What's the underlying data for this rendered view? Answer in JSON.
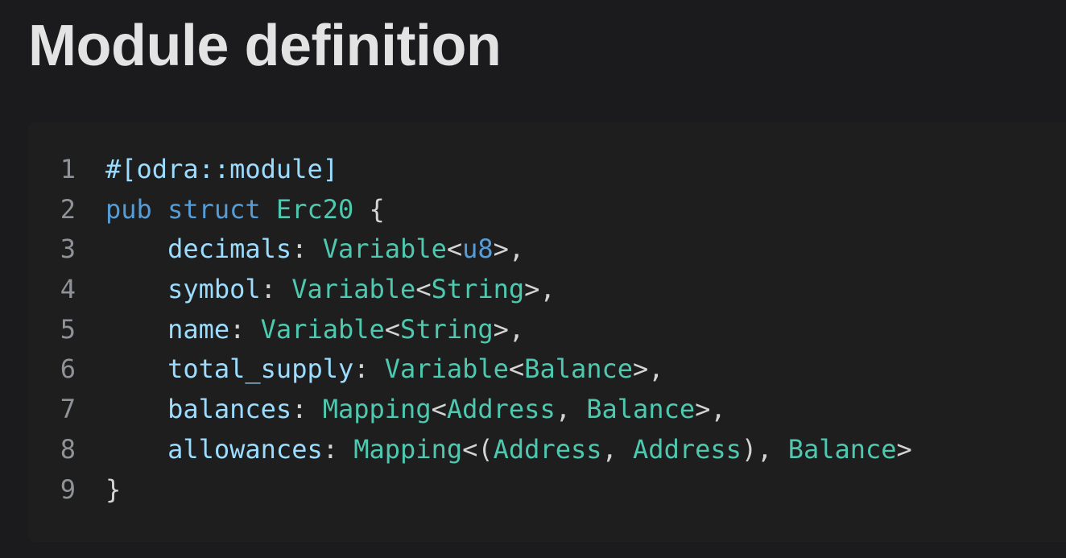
{
  "page": {
    "title": "Module definition"
  },
  "colors": {
    "background": "#1b1b1d",
    "code_background": "#1e1e1e",
    "title_text": "#e3e3e3",
    "line_number": "#8f9398",
    "attribute": "#9cdcfe",
    "keyword": "#569cd6",
    "type": "#4ec9b0",
    "field": "#9cdcfe",
    "punctuation": "#d4d4d4"
  },
  "code": {
    "lines": [
      {
        "number": "1",
        "tokens": [
          {
            "text": "#[odra::module]",
            "kind": "attr"
          }
        ]
      },
      {
        "number": "2",
        "tokens": [
          {
            "text": "pub",
            "kind": "kw"
          },
          {
            "text": " ",
            "kind": "plain"
          },
          {
            "text": "struct",
            "kind": "kw"
          },
          {
            "text": " ",
            "kind": "plain"
          },
          {
            "text": "Erc20",
            "kind": "type"
          },
          {
            "text": " {",
            "kind": "plain"
          }
        ]
      },
      {
        "number": "3",
        "tokens": [
          {
            "text": "    ",
            "kind": "plain"
          },
          {
            "text": "decimals",
            "kind": "field"
          },
          {
            "text": ": ",
            "kind": "plain"
          },
          {
            "text": "Variable",
            "kind": "type"
          },
          {
            "text": "<",
            "kind": "plain"
          },
          {
            "text": "u8",
            "kind": "kw"
          },
          {
            "text": ">,",
            "kind": "plain"
          }
        ]
      },
      {
        "number": "4",
        "tokens": [
          {
            "text": "    ",
            "kind": "plain"
          },
          {
            "text": "symbol",
            "kind": "field"
          },
          {
            "text": ": ",
            "kind": "plain"
          },
          {
            "text": "Variable",
            "kind": "type"
          },
          {
            "text": "<",
            "kind": "plain"
          },
          {
            "text": "String",
            "kind": "type"
          },
          {
            "text": ">,",
            "kind": "plain"
          }
        ]
      },
      {
        "number": "5",
        "tokens": [
          {
            "text": "    ",
            "kind": "plain"
          },
          {
            "text": "name",
            "kind": "field"
          },
          {
            "text": ": ",
            "kind": "plain"
          },
          {
            "text": "Variable",
            "kind": "type"
          },
          {
            "text": "<",
            "kind": "plain"
          },
          {
            "text": "String",
            "kind": "type"
          },
          {
            "text": ">,",
            "kind": "plain"
          }
        ]
      },
      {
        "number": "6",
        "tokens": [
          {
            "text": "    ",
            "kind": "plain"
          },
          {
            "text": "total_supply",
            "kind": "field"
          },
          {
            "text": ": ",
            "kind": "plain"
          },
          {
            "text": "Variable",
            "kind": "type"
          },
          {
            "text": "<",
            "kind": "plain"
          },
          {
            "text": "Balance",
            "kind": "type"
          },
          {
            "text": ">,",
            "kind": "plain"
          }
        ]
      },
      {
        "number": "7",
        "tokens": [
          {
            "text": "    ",
            "kind": "plain"
          },
          {
            "text": "balances",
            "kind": "field"
          },
          {
            "text": ": ",
            "kind": "plain"
          },
          {
            "text": "Mapping",
            "kind": "type"
          },
          {
            "text": "<",
            "kind": "plain"
          },
          {
            "text": "Address",
            "kind": "type"
          },
          {
            "text": ", ",
            "kind": "plain"
          },
          {
            "text": "Balance",
            "kind": "type"
          },
          {
            "text": ">,",
            "kind": "plain"
          }
        ]
      },
      {
        "number": "8",
        "tokens": [
          {
            "text": "    ",
            "kind": "plain"
          },
          {
            "text": "allowances",
            "kind": "field"
          },
          {
            "text": ": ",
            "kind": "plain"
          },
          {
            "text": "Mapping",
            "kind": "type"
          },
          {
            "text": "<(",
            "kind": "plain"
          },
          {
            "text": "Address",
            "kind": "type"
          },
          {
            "text": ", ",
            "kind": "plain"
          },
          {
            "text": "Address",
            "kind": "type"
          },
          {
            "text": "), ",
            "kind": "plain"
          },
          {
            "text": "Balance",
            "kind": "type"
          },
          {
            "text": ">",
            "kind": "plain"
          }
        ]
      },
      {
        "number": "9",
        "tokens": [
          {
            "text": "}",
            "kind": "plain"
          }
        ]
      }
    ]
  }
}
